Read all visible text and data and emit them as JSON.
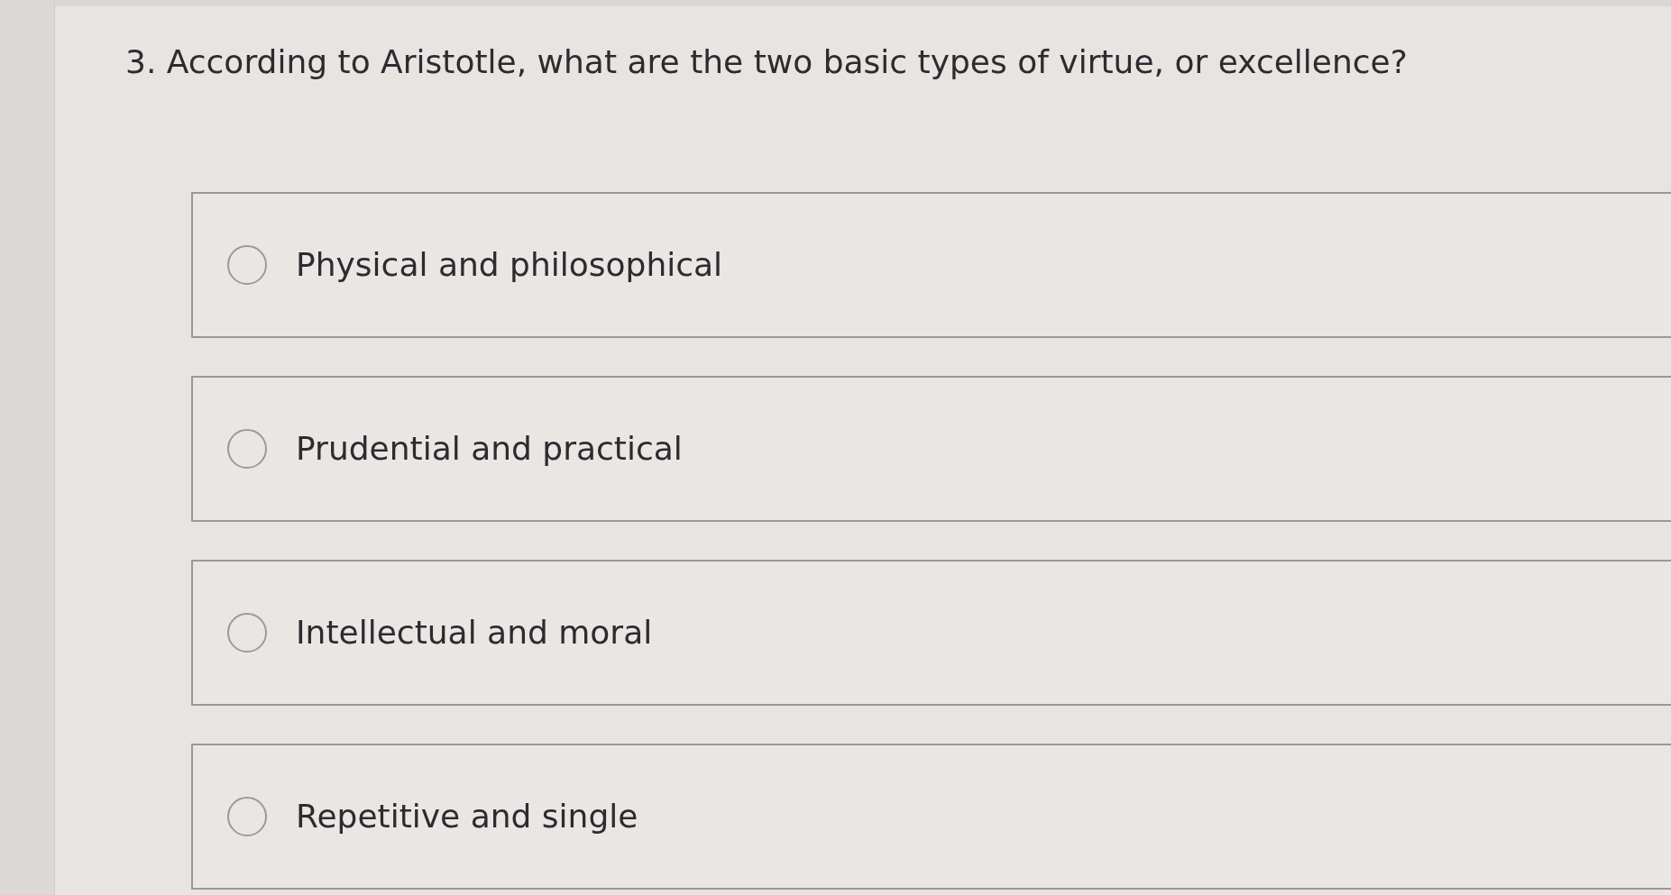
{
  "question": {
    "text": "3. According to Aristotle, what are the two basic types of virtue, or excellence?"
  },
  "options": [
    {
      "label": "Physical and philosophical",
      "selected": false
    },
    {
      "label": "Prudential and practical",
      "selected": false
    },
    {
      "label": "Intellectual and moral",
      "selected": false
    },
    {
      "label": "Repetitive and single",
      "selected": false
    }
  ]
}
